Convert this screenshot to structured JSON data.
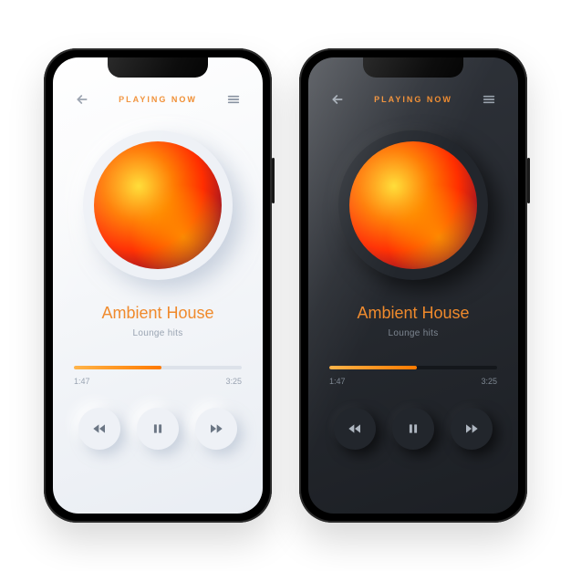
{
  "header": {
    "title": "PLAYING NOW"
  },
  "track": {
    "title": "Ambient House",
    "subtitle": "Lounge hits"
  },
  "progress": {
    "elapsed": "1:47",
    "total": "3:25",
    "percent": 52
  },
  "colors": {
    "accent": "#f08a2c"
  },
  "icons": {
    "back": "back-arrow-icon",
    "menu": "hamburger-icon",
    "prev": "previous-track-icon",
    "pause": "pause-icon",
    "next": "next-track-icon"
  }
}
